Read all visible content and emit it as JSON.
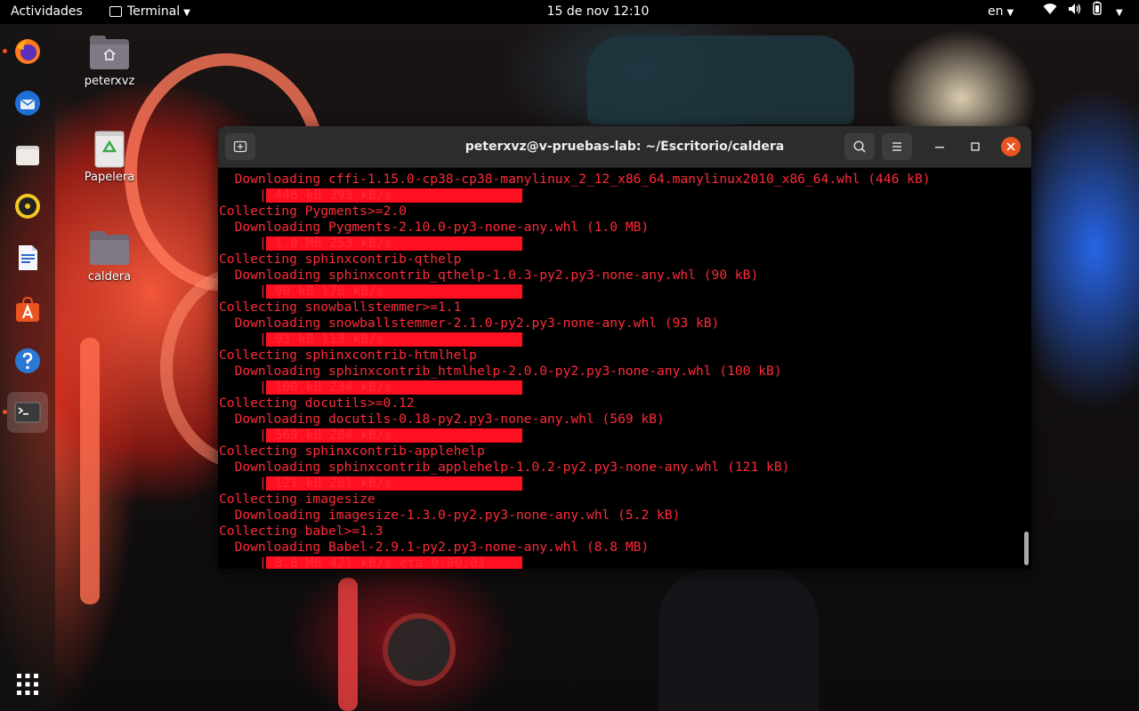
{
  "topbar": {
    "activities": "Actividades",
    "app_name": "Terminal",
    "clock": "15 de nov  12:10",
    "language": "en",
    "tray_icons": [
      "wifi-icon",
      "volume-icon",
      "battery-icon"
    ]
  },
  "dock": {
    "apps": [
      "firefox",
      "thunderbird",
      "files",
      "rhythmbox",
      "libreoffice-writer",
      "software-center",
      "help",
      "terminal"
    ],
    "show_apps": "show-applications-icon"
  },
  "desktop": {
    "home_folder": "peterxvz",
    "trash": "Papelera",
    "folder": "caldera"
  },
  "terminal": {
    "title": "peterxvz@v-pruebas-lab: ~/Escritorio/caldera",
    "text_color": "#ff2a38",
    "bar_color": "#ff0f22",
    "lines": {
      "l0": "  Downloading cffi-1.15.0-cp38-cp38-manylinux_2_12_x86_64.manylinux2010_x86_64.whl (446 kB)",
      "l1": "| 446 kB 393 kB/s",
      "l2": "Collecting Pygments>=2.0",
      "l3": "  Downloading Pygments-2.10.0-py3-none-any.whl (1.0 MB)",
      "l4": "| 1.0 MB 253 kB/s",
      "l5": "Collecting sphinxcontrib-qthelp",
      "l6": "  Downloading sphinxcontrib_qthelp-1.0.3-py2.py3-none-any.whl (90 kB)",
      "l7": "| 90 kB 178 kB/s",
      "l8": "Collecting snowballstemmer>=1.1",
      "l9": "  Downloading snowballstemmer-2.1.0-py2.py3-none-any.whl (93 kB)",
      "l10": "| 93 kB 113 kB/s",
      "l11": "Collecting sphinxcontrib-htmlhelp",
      "l12": "  Downloading sphinxcontrib_htmlhelp-2.0.0-py2.py3-none-any.whl (100 kB)",
      "l13": "| 100 kB 234 kB/s",
      "l14": "Collecting docutils>=0.12",
      "l15": "  Downloading docutils-0.18-py2.py3-none-any.whl (569 kB)",
      "l16": "| 569 kB 284 kB/s",
      "l17": "Collecting sphinxcontrib-applehelp",
      "l18": "  Downloading sphinxcontrib_applehelp-1.0.2-py2.py3-none-any.whl (121 kB)",
      "l19": "| 121 kB 281 kB/s",
      "l20": "Collecting imagesize",
      "l21": "  Downloading imagesize-1.3.0-py2.py3-none-any.whl (5.2 kB)",
      "l22": "Collecting babel>=1.3",
      "l23": "  Downloading Babel-2.9.1-py2.py3-none-any.whl (8.8 MB)",
      "l24": "| 8.8 MB 421 kB/s eta 0:00:01"
    },
    "progress": [
      1.0,
      1.0,
      1.0,
      1.0,
      1.0,
      1.0,
      1.0,
      1.0
    ]
  }
}
